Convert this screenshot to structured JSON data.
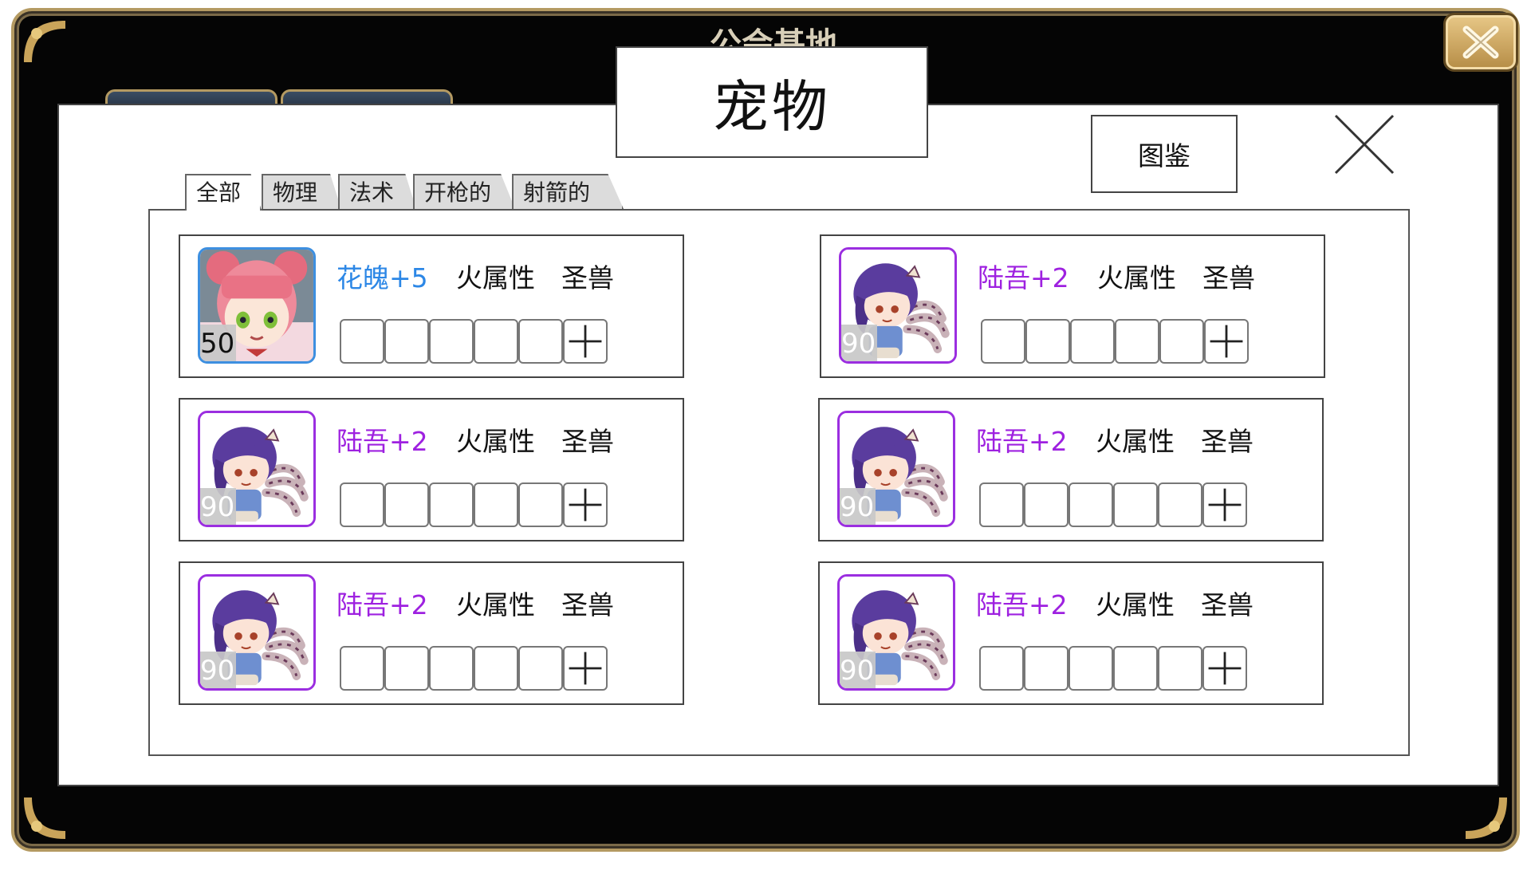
{
  "background": {
    "title_partial": "公会基地"
  },
  "dialog": {
    "title": "宠物",
    "handbook_label": "图鉴",
    "tabs": [
      {
        "label": "全部",
        "active": true
      },
      {
        "label": "物理",
        "active": false
      },
      {
        "label": "法术",
        "active": false
      },
      {
        "label": "开枪的",
        "active": false
      },
      {
        "label": "射箭的",
        "active": false
      }
    ]
  },
  "pets": [
    {
      "name": "花魄+5",
      "name_color": "#2c87e6",
      "frame": "blue",
      "level": "50",
      "attribute": "火属性",
      "type": "圣兽",
      "portrait": "pink-hair-girl"
    },
    {
      "name": "陆吾+2",
      "name_color": "#9e21e0",
      "frame": "purple",
      "level": "90",
      "attribute": "火属性",
      "type": "圣兽",
      "portrait": "tiger-tail-girl"
    },
    {
      "name": "陆吾+2",
      "name_color": "#9e21e0",
      "frame": "purple",
      "level": "90",
      "attribute": "火属性",
      "type": "圣兽",
      "portrait": "tiger-tail-girl"
    },
    {
      "name": "陆吾+2",
      "name_color": "#9e21e0",
      "frame": "purple",
      "level": "90",
      "attribute": "火属性",
      "type": "圣兽",
      "portrait": "tiger-tail-girl"
    },
    {
      "name": "陆吾+2",
      "name_color": "#9e21e0",
      "frame": "purple",
      "level": "90",
      "attribute": "火属性",
      "type": "圣兽",
      "portrait": "tiger-tail-girl"
    },
    {
      "name": "陆吾+2",
      "name_color": "#9e21e0",
      "frame": "purple",
      "level": "90",
      "attribute": "火属性",
      "type": "圣兽",
      "portrait": "tiger-tail-girl"
    }
  ],
  "slots_per_pet": 5,
  "icons": {
    "window_close": "close-icon",
    "panel_close": "close-icon",
    "slot_add": "plus-icon"
  }
}
